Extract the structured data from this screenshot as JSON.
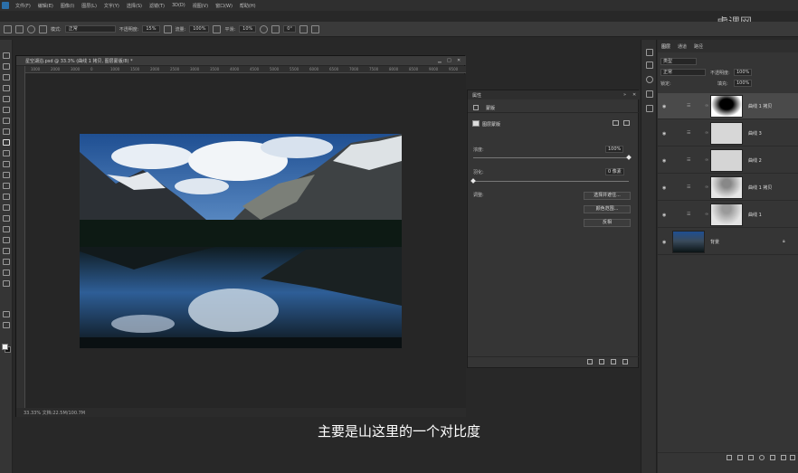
{
  "menubar": {
    "items": [
      "文件(F)",
      "编辑(E)",
      "图像(I)",
      "图层(L)",
      "文字(Y)",
      "选择(S)",
      "滤镜(T)",
      "3D(D)",
      "视图(V)",
      "窗口(W)",
      "帮助(H)"
    ]
  },
  "optionsbar": {
    "mode_label": "模式:",
    "mode_value": "正常",
    "opacity_label": "不透明度:",
    "opacity_value": "15%",
    "flow_label": "流量:",
    "flow_value": "100%",
    "smoothing_label": "平滑:",
    "smoothing_value": "10%",
    "angle_value": "0°"
  },
  "document": {
    "title": "星空湖泊.psd @ 33.3% (曲线 1 拷贝, 图层蒙版/8) *",
    "status": "33.33%   文档:22.5M/100.7M",
    "ruler_ticks": [
      "1000",
      "2000",
      "3000",
      "0",
      "1000",
      "1500",
      "2000",
      "2500",
      "3000",
      "3500",
      "4000",
      "4500",
      "5000",
      "5500",
      "6000",
      "6500",
      "7000",
      "7500",
      "8000",
      "8500",
      "9000",
      "9500"
    ]
  },
  "properties": {
    "title": "属性",
    "mask_label": "蒙版",
    "layer_mask_label": "图层蒙版",
    "density_label": "浓度:",
    "density_value": "100%",
    "density_fraction": 1.0,
    "feather_label": "羽化:",
    "feather_value": "0 像素",
    "feather_fraction": 0.0,
    "refine_label": "调整:",
    "buttons": [
      "选择并遮住...",
      "颜色范围...",
      "反相"
    ]
  },
  "layers": {
    "tabs": [
      "图层",
      "通道",
      "路径"
    ],
    "kind_label": "类型",
    "blend_value": "正常",
    "opacity_label": "不透明度:",
    "opacity_value": "100%",
    "lock_label": "锁定:",
    "fill_label": "填充:",
    "fill_value": "100%",
    "rows": [
      {
        "name": "曲线 1 拷贝",
        "selected": true
      },
      {
        "name": "曲线 3",
        "selected": false
      },
      {
        "name": "曲线 2",
        "selected": false
      },
      {
        "name": "曲线 1 拷贝",
        "selected": false
      },
      {
        "name": "曲线 1",
        "selected": false
      },
      {
        "name": "背景",
        "selected": false
      }
    ]
  },
  "watermark": "虎课网",
  "subtitle": "主要是山这里的一个对比度",
  "colors": {
    "app_bg": "#282828",
    "panel_bg": "#353535",
    "selected_row": "#4a4a4a",
    "ps_blue": "#2b6fa9"
  }
}
